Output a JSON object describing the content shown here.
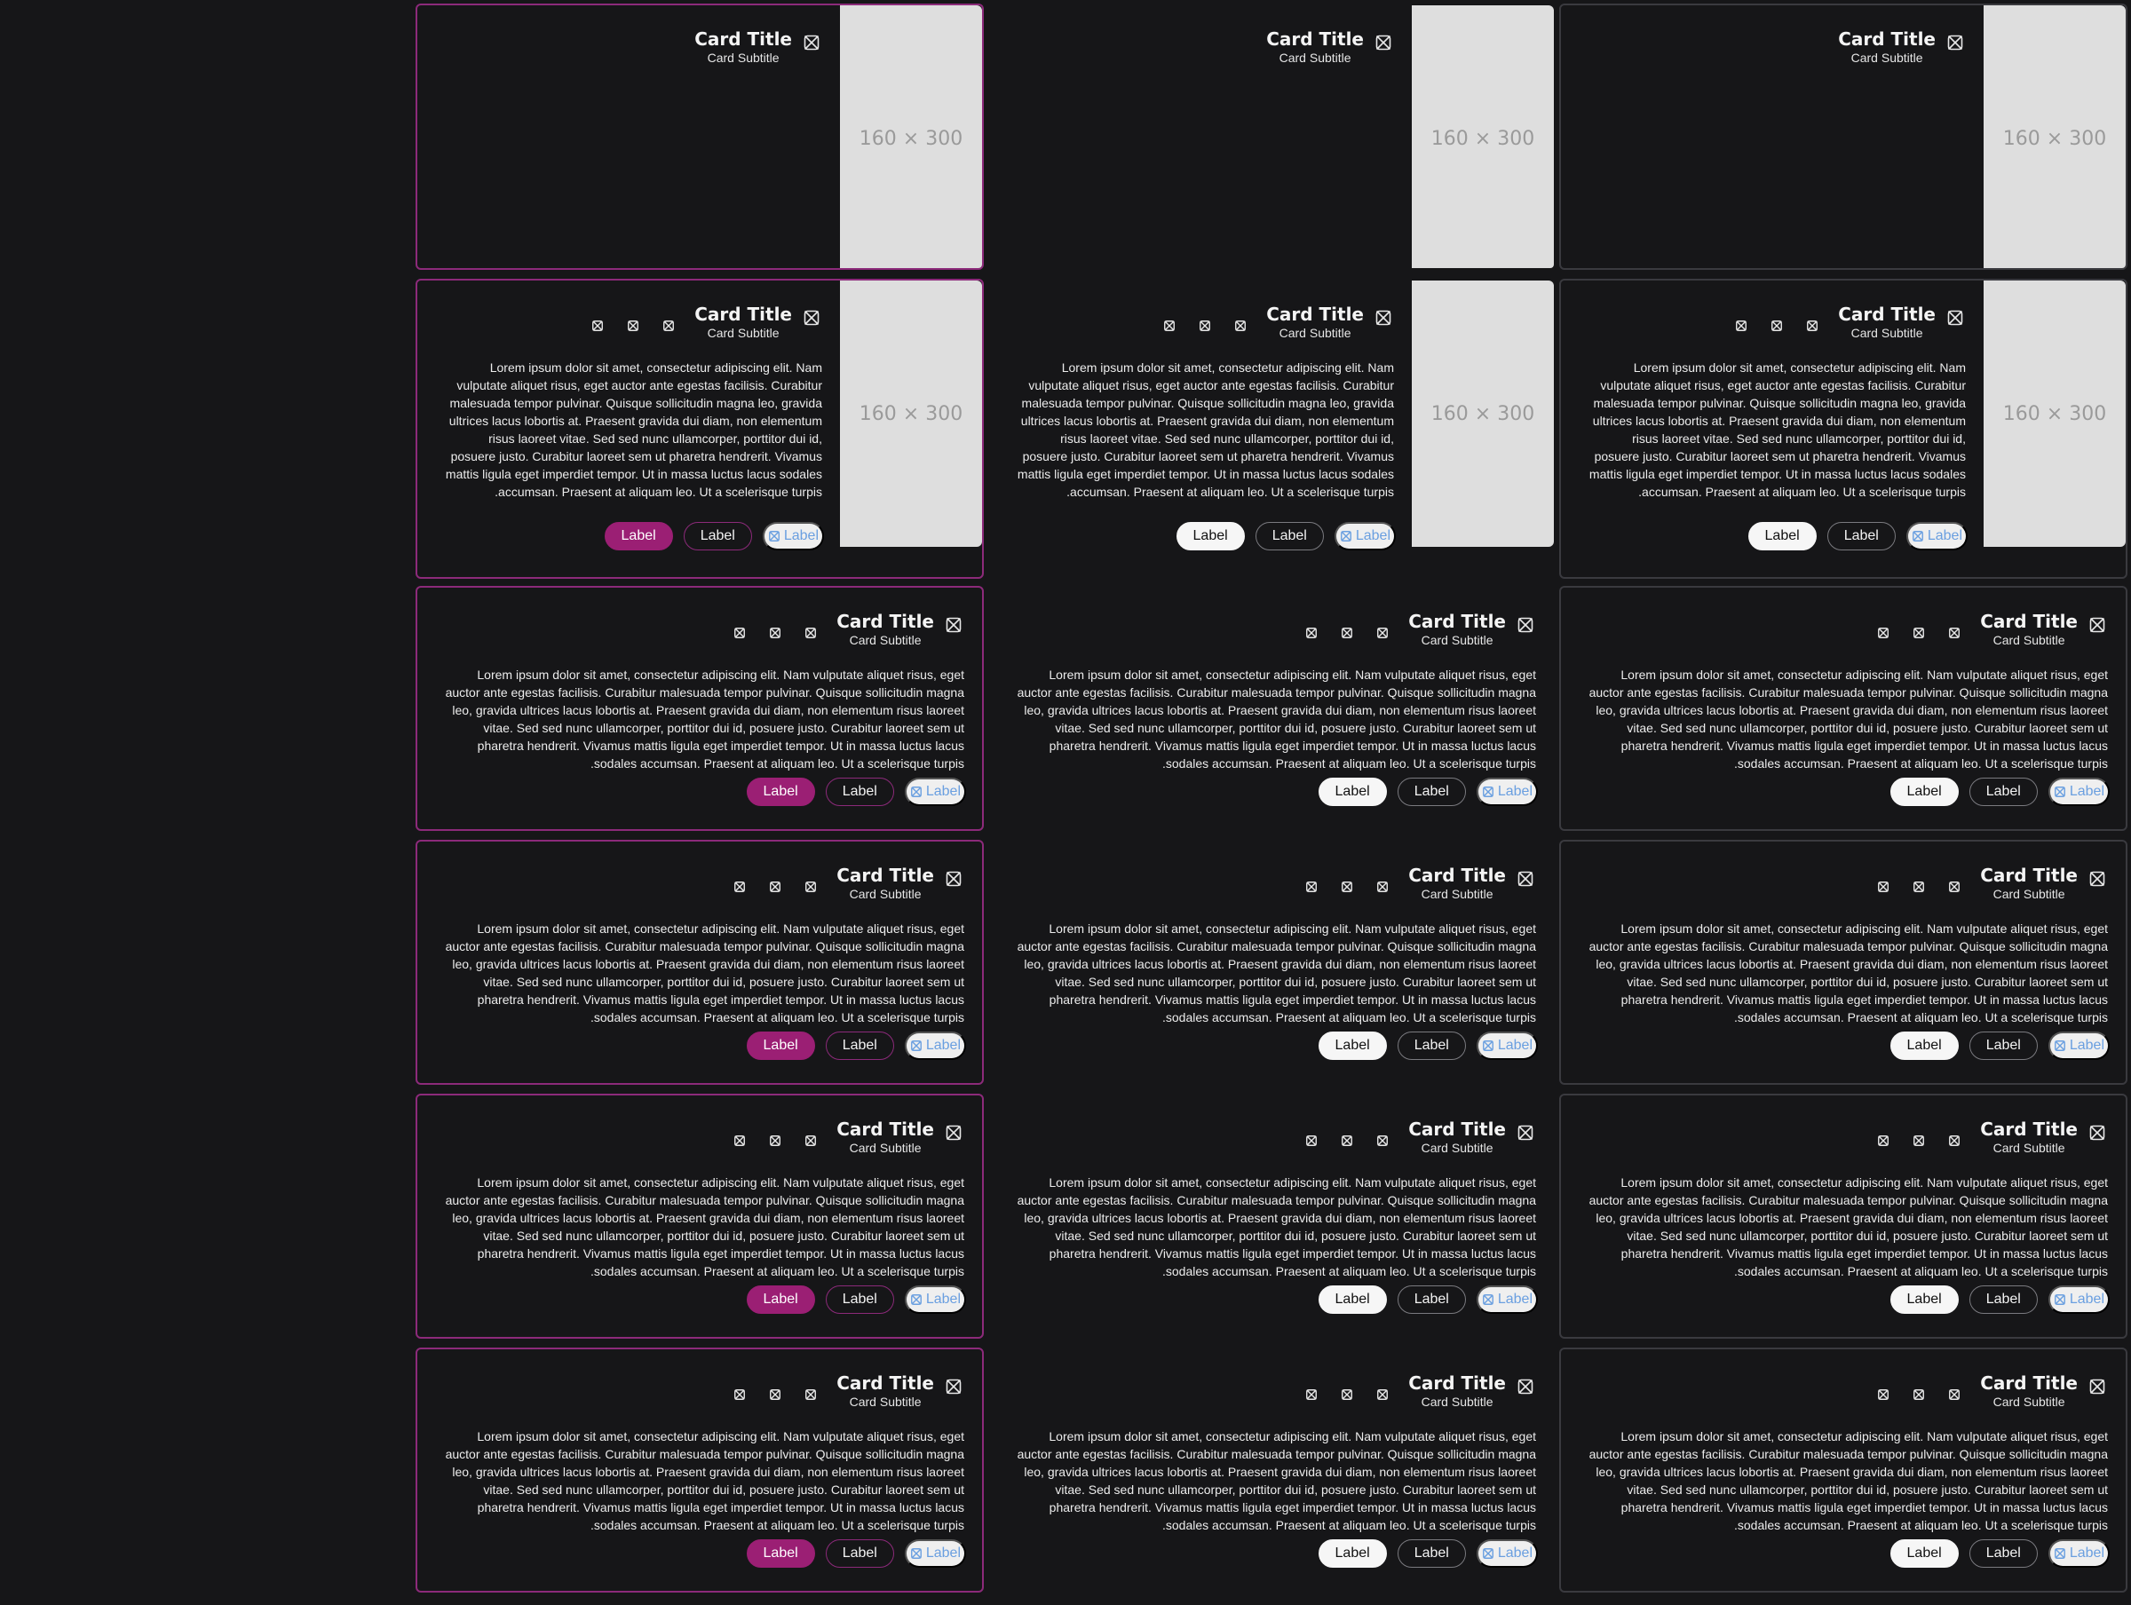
{
  "cards": [
    {
      "variant": "accent",
      "col": 0,
      "row": 0,
      "title": "Card Title",
      "subtitle": "Card Subtitle",
      "media": "160 × 300"
    },
    {
      "variant": "plain",
      "col": 1,
      "row": 0,
      "title": "Card Title",
      "subtitle": "Card Subtitle",
      "media": "160 × 300"
    },
    {
      "variant": "gray",
      "col": 2,
      "row": 0,
      "title": "Card Title",
      "subtitle": "Card Subtitle",
      "media": "160 × 300"
    },
    {
      "variant": "accent",
      "col": 0,
      "row": 1,
      "title": "Card Title",
      "subtitle": "Card Subtitle",
      "media": "160 × 300",
      "text": "Lorem ipsum dolor sit amet, consectetur adipiscing elit. Nam vulputate aliquet risus, eget auctor ante egestas facilisis. Curabitur malesuada tempor pulvinar. Quisque sollicitudin magna leo, gravida ultrices lacus lobortis at. Praesent gravida dui diam, non elementum risus laoreet vitae. Sed sed nunc ullamcorper, porttitor dui id, posuere justo. Curabitur laoreet sem ut pharetra hendrerit. Vivamus mattis ligula eget imperdiet tempor. Ut in massa luctus lacus sodales accumsan. Praesent at aliquam leo. Ut a scelerisque turpis.",
      "buttons": [
        "Label",
        "Label",
        "Label"
      ]
    },
    {
      "variant": "plain",
      "col": 1,
      "row": 1,
      "title": "Card Title",
      "subtitle": "Card Subtitle",
      "media": "160 × 300",
      "text": "Lorem ipsum dolor sit amet, consectetur adipiscing elit. Nam vulputate aliquet risus, eget auctor ante egestas facilisis. Curabitur malesuada tempor pulvinar. Quisque sollicitudin magna leo, gravida ultrices lacus lobortis at. Praesent gravida dui diam, non elementum risus laoreet vitae. Sed sed nunc ullamcorper, porttitor dui id, posuere justo. Curabitur laoreet sem ut pharetra hendrerit. Vivamus mattis ligula eget imperdiet tempor. Ut in massa luctus lacus sodales accumsan. Praesent at aliquam leo. Ut a scelerisque turpis.",
      "buttons": [
        "Label",
        "Label",
        "Label"
      ]
    },
    {
      "variant": "gray",
      "col": 2,
      "row": 1,
      "title": "Card Title",
      "subtitle": "Card Subtitle",
      "media": "160 × 300",
      "text": "Lorem ipsum dolor sit amet, consectetur adipiscing elit. Nam vulputate aliquet risus, eget auctor ante egestas facilisis. Curabitur malesuada tempor pulvinar. Quisque sollicitudin magna leo, gravida ultrices lacus lobortis at. Praesent gravida dui diam, non elementum risus laoreet vitae. Sed sed nunc ullamcorper, porttitor dui id, posuere justo. Curabitur laoreet sem ut pharetra hendrerit. Vivamus mattis ligula eget imperdiet tempor. Ut in massa luctus lacus sodales accumsan. Praesent at aliquam leo. Ut a scelerisque turpis.",
      "buttons": [
        "Label",
        "Label",
        "Label"
      ]
    },
    {
      "variant": "accent",
      "col": 0,
      "row": 2,
      "title": "Card Title",
      "subtitle": "Card Subtitle",
      "text": "Lorem ipsum dolor sit amet, consectetur adipiscing elit. Nam vulputate aliquet risus, eget auctor ante egestas facilisis. Curabitur malesuada tempor pulvinar. Quisque sollicitudin magna leo, gravida ultrices lacus lobortis at. Praesent gravida dui diam, non elementum risus laoreet vitae. Sed sed nunc ullamcorper, porttitor dui id, posuere justo. Curabitur laoreet sem ut pharetra hendrerit. Vivamus mattis ligula eget imperdiet tempor. Ut in massa luctus lacus sodales accumsan. Praesent at aliquam leo. Ut a scelerisque turpis.",
      "buttons": [
        "Label",
        "Label",
        "Label"
      ]
    },
    {
      "variant": "plain",
      "col": 1,
      "row": 2,
      "title": "Card Title",
      "subtitle": "Card Subtitle",
      "text": "Lorem ipsum dolor sit amet, consectetur adipiscing elit. Nam vulputate aliquet risus, eget auctor ante egestas facilisis. Curabitur malesuada tempor pulvinar. Quisque sollicitudin magna leo, gravida ultrices lacus lobortis at. Praesent gravida dui diam, non elementum risus laoreet vitae. Sed sed nunc ullamcorper, porttitor dui id, posuere justo. Curabitur laoreet sem ut pharetra hendrerit. Vivamus mattis ligula eget imperdiet tempor. Ut in massa luctus lacus sodales accumsan. Praesent at aliquam leo. Ut a scelerisque turpis.",
      "buttons": [
        "Label",
        "Label",
        "Label"
      ]
    },
    {
      "variant": "gray",
      "col": 2,
      "row": 2,
      "title": "Card Title",
      "subtitle": "Card Subtitle",
      "text": "Lorem ipsum dolor sit amet, consectetur adipiscing elit. Nam vulputate aliquet risus, eget auctor ante egestas facilisis. Curabitur malesuada tempor pulvinar. Quisque sollicitudin magna leo, gravida ultrices lacus lobortis at. Praesent gravida dui diam, non elementum risus laoreet vitae. Sed sed nunc ullamcorper, porttitor dui id, posuere justo. Curabitur laoreet sem ut pharetra hendrerit. Vivamus mattis ligula eget imperdiet tempor. Ut in massa luctus lacus sodales accumsan. Praesent at aliquam leo. Ut a scelerisque turpis.",
      "buttons": [
        "Label",
        "Label",
        "Label"
      ]
    },
    {
      "variant": "accent",
      "col": 0,
      "row": 3,
      "title": "Card Title",
      "subtitle": "Card Subtitle",
      "text": "Lorem ipsum dolor sit amet, consectetur adipiscing elit. Nam vulputate aliquet risus, eget auctor ante egestas facilisis. Curabitur malesuada tempor pulvinar. Quisque sollicitudin magna leo, gravida ultrices lacus lobortis at. Praesent gravida dui diam, non elementum risus laoreet vitae. Sed sed nunc ullamcorper, porttitor dui id, posuere justo. Curabitur laoreet sem ut pharetra hendrerit. Vivamus mattis ligula eget imperdiet tempor. Ut in massa luctus lacus sodales accumsan. Praesent at aliquam leo. Ut a scelerisque turpis.",
      "buttons": [
        "Label",
        "Label",
        "Label"
      ]
    },
    {
      "variant": "plain",
      "col": 1,
      "row": 3,
      "title": "Card Title",
      "subtitle": "Card Subtitle",
      "text": "Lorem ipsum dolor sit amet, consectetur adipiscing elit. Nam vulputate aliquet risus, eget auctor ante egestas facilisis. Curabitur malesuada tempor pulvinar. Quisque sollicitudin magna leo, gravida ultrices lacus lobortis at. Praesent gravida dui diam, non elementum risus laoreet vitae. Sed sed nunc ullamcorper, porttitor dui id, posuere justo. Curabitur laoreet sem ut pharetra hendrerit. Vivamus mattis ligula eget imperdiet tempor. Ut in massa luctus lacus sodales accumsan. Praesent at aliquam leo. Ut a scelerisque turpis.",
      "buttons": [
        "Label",
        "Label",
        "Label"
      ]
    },
    {
      "variant": "gray",
      "col": 2,
      "row": 3,
      "title": "Card Title",
      "subtitle": "Card Subtitle",
      "text": "Lorem ipsum dolor sit amet, consectetur adipiscing elit. Nam vulputate aliquet risus, eget auctor ante egestas facilisis. Curabitur malesuada tempor pulvinar. Quisque sollicitudin magna leo, gravida ultrices lacus lobortis at. Praesent gravida dui diam, non elementum risus laoreet vitae. Sed sed nunc ullamcorper, porttitor dui id, posuere justo. Curabitur laoreet sem ut pharetra hendrerit. Vivamus mattis ligula eget imperdiet tempor. Ut in massa luctus lacus sodales accumsan. Praesent at aliquam leo. Ut a scelerisque turpis.",
      "buttons": [
        "Label",
        "Label",
        "Label"
      ]
    },
    {
      "variant": "accent",
      "col": 0,
      "row": 4,
      "title": "Card Title",
      "subtitle": "Card Subtitle",
      "text": "Lorem ipsum dolor sit amet, consectetur adipiscing elit. Nam vulputate aliquet risus, eget auctor ante egestas facilisis. Curabitur malesuada tempor pulvinar. Quisque sollicitudin magna leo, gravida ultrices lacus lobortis at. Praesent gravida dui diam, non elementum risus laoreet vitae. Sed sed nunc ullamcorper, porttitor dui id, posuere justo. Curabitur laoreet sem ut pharetra hendrerit. Vivamus mattis ligula eget imperdiet tempor. Ut in massa luctus lacus sodales accumsan. Praesent at aliquam leo. Ut a scelerisque turpis.",
      "buttons": [
        "Label",
        "Label",
        "Label"
      ]
    },
    {
      "variant": "plain",
      "col": 1,
      "row": 4,
      "title": "Card Title",
      "subtitle": "Card Subtitle",
      "text": "Lorem ipsum dolor sit amet, consectetur adipiscing elit. Nam vulputate aliquet risus, eget auctor ante egestas facilisis. Curabitur malesuada tempor pulvinar. Quisque sollicitudin magna leo, gravida ultrices lacus lobortis at. Praesent gravida dui diam, non elementum risus laoreet vitae. Sed sed nunc ullamcorper, porttitor dui id, posuere justo. Curabitur laoreet sem ut pharetra hendrerit. Vivamus mattis ligula eget imperdiet tempor. Ut in massa luctus lacus sodales accumsan. Praesent at aliquam leo. Ut a scelerisque turpis.",
      "buttons": [
        "Label",
        "Label",
        "Label"
      ]
    },
    {
      "variant": "gray",
      "col": 2,
      "row": 4,
      "title": "Card Title",
      "subtitle": "Card Subtitle",
      "text": "Lorem ipsum dolor sit amet, consectetur adipiscing elit. Nam vulputate aliquet risus, eget auctor ante egestas facilisis. Curabitur malesuada tempor pulvinar. Quisque sollicitudin magna leo, gravida ultrices lacus lobortis at. Praesent gravida dui diam, non elementum risus laoreet vitae. Sed sed nunc ullamcorper, porttitor dui id, posuere justo. Curabitur laoreet sem ut pharetra hendrerit. Vivamus mattis ligula eget imperdiet tempor. Ut in massa luctus lacus sodales accumsan. Praesent at aliquam leo. Ut a scelerisque turpis.",
      "buttons": [
        "Label",
        "Label",
        "Label"
      ]
    },
    {
      "variant": "accent",
      "col": 0,
      "row": 5,
      "title": "Card Title",
      "subtitle": "Card Subtitle",
      "text": "Lorem ipsum dolor sit amet, consectetur adipiscing elit. Nam vulputate aliquet risus, eget auctor ante egestas facilisis. Curabitur malesuada tempor pulvinar. Quisque sollicitudin magna leo, gravida ultrices lacus lobortis at. Praesent gravida dui diam, non elementum risus laoreet vitae. Sed sed nunc ullamcorper, porttitor dui id, posuere justo. Curabitur laoreet sem ut pharetra hendrerit. Vivamus mattis ligula eget imperdiet tempor. Ut in massa luctus lacus sodales accumsan. Praesent at aliquam leo. Ut a scelerisque turpis.",
      "buttons": [
        "Label",
        "Label",
        "Label"
      ]
    },
    {
      "variant": "plain",
      "col": 1,
      "row": 5,
      "title": "Card Title",
      "subtitle": "Card Subtitle",
      "text": "Lorem ipsum dolor sit amet, consectetur adipiscing elit. Nam vulputate aliquet risus, eget auctor ante egestas facilisis. Curabitur malesuada tempor pulvinar. Quisque sollicitudin magna leo, gravida ultrices lacus lobortis at. Praesent gravida dui diam, non elementum risus laoreet vitae. Sed sed nunc ullamcorper, porttitor dui id, posuere justo. Curabitur laoreet sem ut pharetra hendrerit. Vivamus mattis ligula eget imperdiet tempor. Ut in massa luctus lacus sodales accumsan. Praesent at aliquam leo. Ut a scelerisque turpis.",
      "buttons": [
        "Label",
        "Label",
        "Label"
      ]
    },
    {
      "variant": "gray",
      "col": 2,
      "row": 5,
      "title": "Card Title",
      "subtitle": "Card Subtitle",
      "text": "Lorem ipsum dolor sit amet, consectetur adipiscing elit. Nam vulputate aliquet risus, eget auctor ante egestas facilisis. Curabitur malesuada tempor pulvinar. Quisque sollicitudin magna leo, gravida ultrices lacus lobortis at. Praesent gravida dui diam, non elementum risus laoreet vitae. Sed sed nunc ullamcorper, porttitor dui id, posuere justo. Curabitur laoreet sem ut pharetra hendrerit. Vivamus mattis ligula eget imperdiet tempor. Ut in massa luctus lacus sodales accumsan. Praesent at aliquam leo. Ut a scelerisque turpis.",
      "buttons": [
        "Label",
        "Label",
        "Label"
      ]
    }
  ],
  "icons": {
    "card_icon": "placeholder-icon",
    "action_icon": "placeholder-icon"
  },
  "colors": {
    "accent": "#9b1f74",
    "accent_border": "#8c2a7a",
    "link": "#6a9fe0",
    "background": "#161618"
  }
}
